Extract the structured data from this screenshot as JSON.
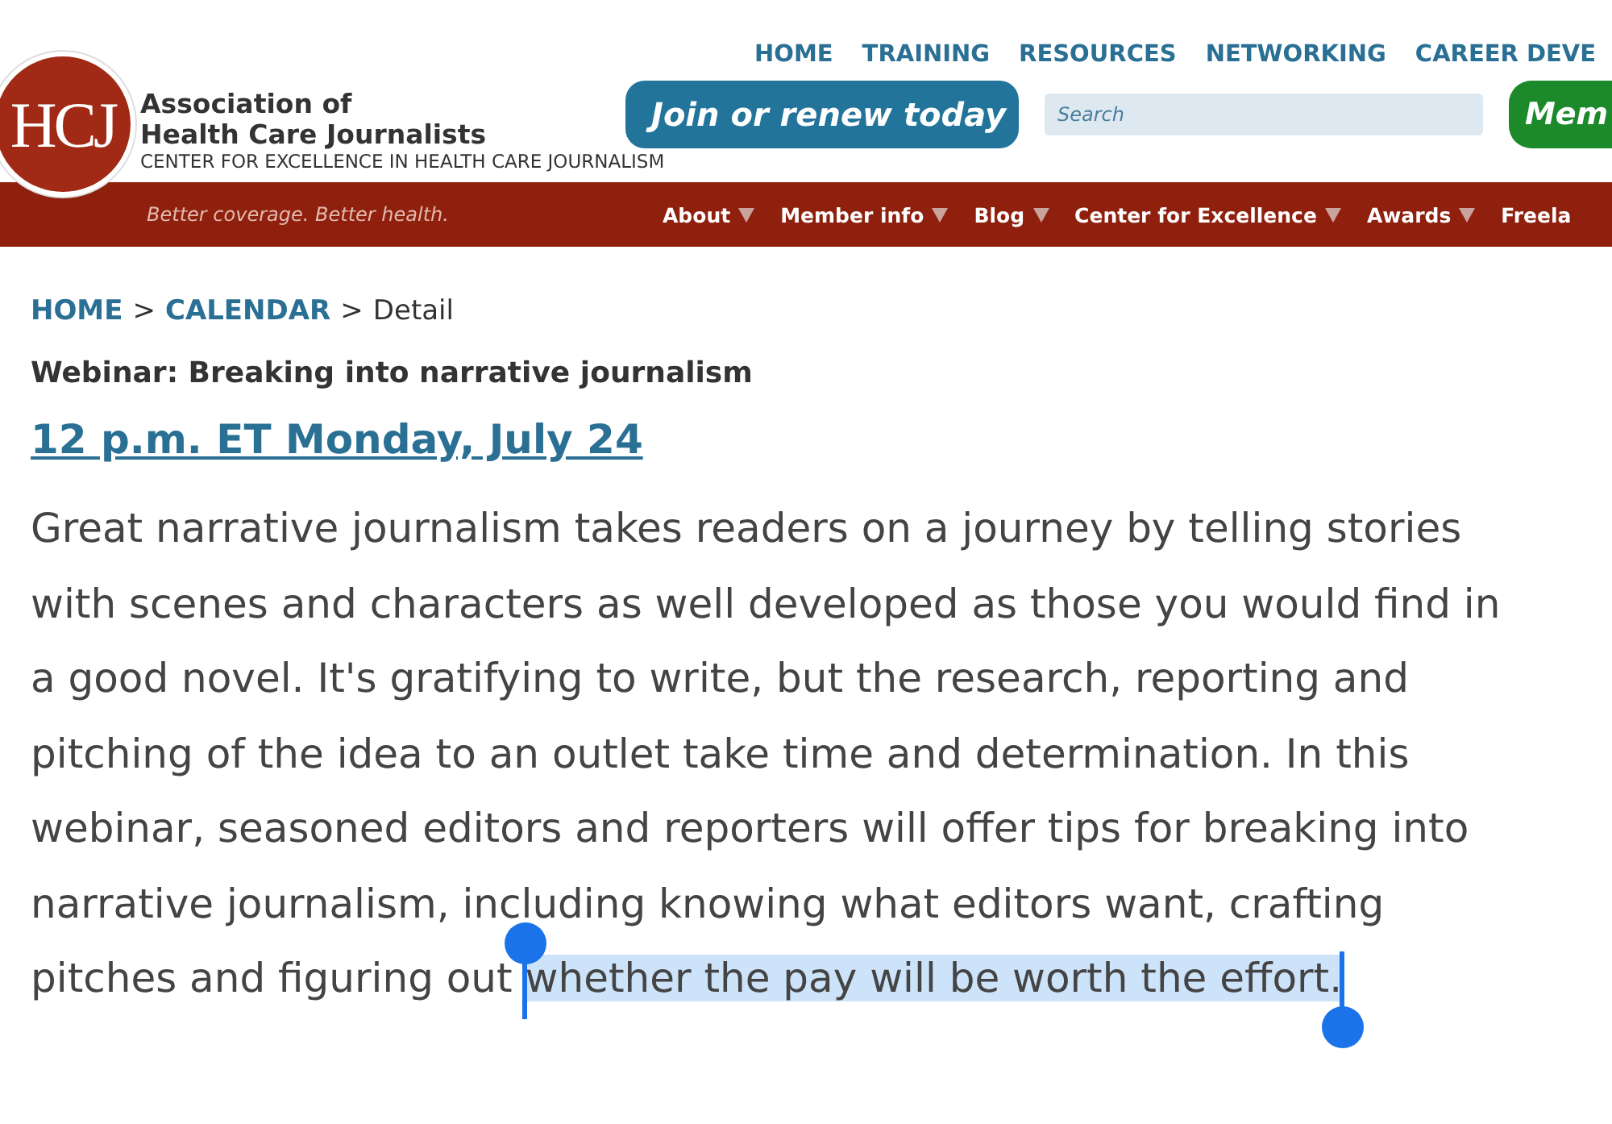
{
  "logo": {
    "letters": "HCJ",
    "name_line_1": "Association of",
    "name_line_2": "Health Care Journalists",
    "subtitle": "CENTER FOR EXCELLENCE IN HEALTH CARE JOURNALISM"
  },
  "top_nav": [
    "HOME",
    "TRAINING",
    "RESOURCES",
    "NETWORKING",
    "CAREER DEVE"
  ],
  "join_button": "Join or renew today",
  "search": {
    "placeholder": "Search"
  },
  "member_button": "Mem",
  "tagline": "Better coverage. Better health.",
  "main_nav": [
    {
      "label": "About",
      "dropdown": true
    },
    {
      "label": "Member info",
      "dropdown": true
    },
    {
      "label": "Blog",
      "dropdown": true
    },
    {
      "label": "Center for Excellence",
      "dropdown": true
    },
    {
      "label": "Awards",
      "dropdown": true
    },
    {
      "label": "Freela",
      "dropdown": false
    }
  ],
  "breadcrumb": [
    {
      "label": "HOME",
      "link": true
    },
    {
      "label": "CALENDAR",
      "link": true
    },
    {
      "label": "Detail",
      "link": false
    }
  ],
  "breadcrumb_separator": ">",
  "event_title": "Webinar: Breaking into narrative journalism",
  "event_time": "12 p.m. ET Monday, July 24",
  "description": {
    "text": "Great narrative journalism takes readers on a journey by telling stories with scenes and characters as well developed as those you would find in a good novel. It's gratifying to write, but the research, reporting and pitching of the idea to an outlet take time and determination. In this webinar, seasoned editors and reporters will offer tips for breaking into narrative journalism, including knowing what editors want, crafting pitches and figuring out ",
    "selected_text": "whether the pay will be worth the effort."
  }
}
